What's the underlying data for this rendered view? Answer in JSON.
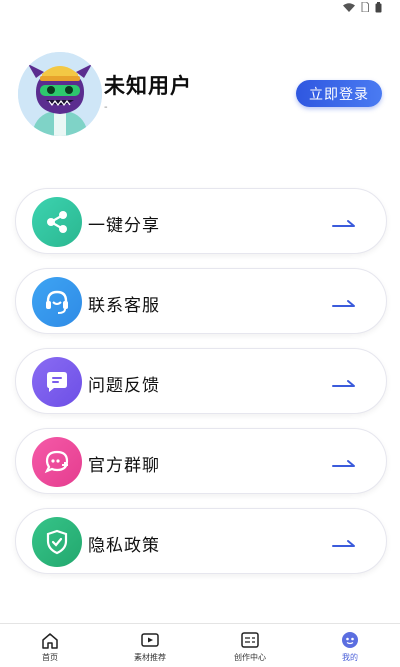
{
  "profile": {
    "username": "未知用户",
    "subtitle": "-",
    "login_label": "立即登录"
  },
  "menu": [
    {
      "label": "一键分享",
      "icon": "share-icon",
      "color_from": "#3cd3b0",
      "color_to": "#2bb790"
    },
    {
      "label": "联系客服",
      "icon": "headset-icon",
      "color_from": "#3ea4f3",
      "color_to": "#2f8be6"
    },
    {
      "label": "问题反馈",
      "icon": "feedback-chat-icon",
      "color_from": "#8a6cf3",
      "color_to": "#6d4fe6"
    },
    {
      "label": "官方群聊",
      "icon": "group-chat-icon",
      "color_from": "#f55aa8",
      "color_to": "#e53d8f"
    },
    {
      "label": "隐私政策",
      "icon": "shield-check-icon",
      "color_from": "#36c489",
      "color_to": "#23a86e"
    }
  ],
  "nav": [
    {
      "label": "首页",
      "icon": "home-icon",
      "active": false
    },
    {
      "label": "素材推荐",
      "icon": "video-icon",
      "active": false
    },
    {
      "label": "创作中心",
      "icon": "document-icon",
      "active": false
    },
    {
      "label": "我的",
      "icon": "profile-face-icon",
      "active": true
    }
  ],
  "colors": {
    "accent": "#2f57e0",
    "arrow": "#3b5bdb",
    "nav_active": "#4a5fd8"
  }
}
